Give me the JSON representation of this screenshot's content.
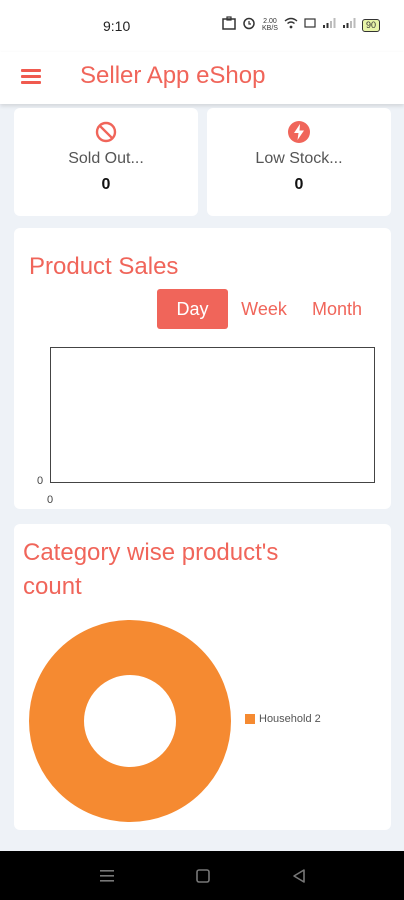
{
  "status_bar": {
    "time": "9:10",
    "data_speed": "2.00 KB/S",
    "battery": "90"
  },
  "app_bar": {
    "title": "Seller App eShop",
    "menu_icon": "hamburger-menu-icon"
  },
  "stats": [
    {
      "label": "Sold Out...",
      "value": "0",
      "icon": "block-icon",
      "color": "#f0655a"
    },
    {
      "label": "Low Stock...",
      "value": "0",
      "icon": "lightning-icon",
      "color": "#f0655a"
    }
  ],
  "product_sales": {
    "title": "Product Sales",
    "periods": [
      "Day",
      "Week",
      "Month"
    ],
    "selected": "Day",
    "y_tick": "0",
    "x_tick": "0"
  },
  "category_count": {
    "title_line1": "Category wise product's",
    "title_line2": "count"
  },
  "chart_data": {
    "type": "pie",
    "categories": [
      "Household"
    ],
    "values": [
      2
    ],
    "legend": [
      "Household 2"
    ],
    "colors": [
      "#f58a31"
    ],
    "legend_position": "right"
  },
  "nav": {
    "recents_icon": "recents-icon",
    "home_icon": "home-icon",
    "back_icon": "back-icon"
  },
  "colors": {
    "accent": "#f0655a",
    "chart_orange": "#f58a31",
    "background": "#eef2f7"
  }
}
